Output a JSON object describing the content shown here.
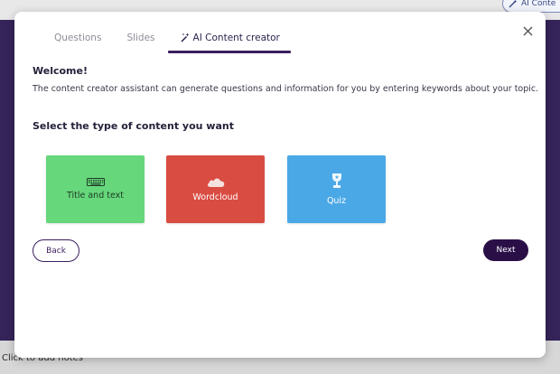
{
  "background": {
    "notes_placeholder": "Click to add notes",
    "ai_button_label": "AI Conte"
  },
  "dialog": {
    "tabs": [
      {
        "label": "Questions"
      },
      {
        "label": "Slides"
      },
      {
        "label": "AI Content creator",
        "active": true
      }
    ],
    "welcome_title": "Welcome!",
    "welcome_text": "The content creator assistant can generate questions and information for you by entering keywords about your topic.",
    "section_title": "Select the type of content you want",
    "cards": [
      {
        "label": "Title and text",
        "icon": "keyboard-icon",
        "color": "#66d77b"
      },
      {
        "label": "Wordcloud",
        "icon": "cloud-icon",
        "color": "#d94c42"
      },
      {
        "label": "Quiz",
        "icon": "trophy-icon",
        "color": "#4aa8e6"
      }
    ],
    "back_label": "Back",
    "next_label": "Next"
  },
  "colors": {
    "accent": "#3b1e5e",
    "background_purple": "#35245a"
  }
}
